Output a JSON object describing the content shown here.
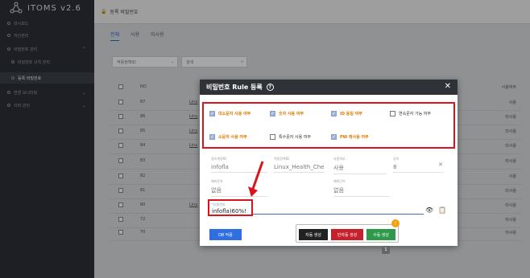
{
  "app": {
    "name": "ITOMS v2.6"
  },
  "sidebar": {
    "items": [
      {
        "label": "대시보드"
      },
      {
        "label": "자산관리"
      },
      {
        "label": "비밀번호 관리"
      },
      {
        "label": "비밀번호 규칙 관리"
      },
      {
        "label": "등록 비밀번호"
      },
      {
        "label": "변경 모니터링"
      },
      {
        "label": "이력 관리"
      }
    ]
  },
  "topbar": {
    "title": "등록 비밀번호"
  },
  "tabs": [
    {
      "label": "전체"
    },
    {
      "label": "사용"
    },
    {
      "label": "미사용"
    }
  ],
  "filter": {
    "select_value": "적용정책ID",
    "search_placeholder": "검색"
  },
  "table": {
    "headers": {
      "no": "NO",
      "status": "사용여부"
    },
    "rows": [
      {
        "no": "87",
        "link": "Linu",
        "status": "사용"
      },
      {
        "no": "86",
        "link": "Linu",
        "status": "미사용"
      },
      {
        "no": "85",
        "link": "Linu",
        "status": "미사용"
      },
      {
        "no": "84",
        "link": "Linu",
        "status": "미사용"
      },
      {
        "no": "83",
        "link": "",
        "status": "미사용"
      },
      {
        "no": "82",
        "link": "",
        "status": "사용"
      },
      {
        "no": "81",
        "link": "",
        "status": "미사용"
      },
      {
        "no": "80",
        "link": "Linu",
        "status": "미사용"
      },
      {
        "no": "72",
        "link": "",
        "status": "미사용"
      },
      {
        "no": "70",
        "link": "",
        "status": "미사용"
      }
    ]
  },
  "modal": {
    "title": "비밀번호 Rule 등록",
    "options": [
      {
        "label": "대소문자 사용 여부",
        "checked": true
      },
      {
        "label": "숫자 사용 여부",
        "checked": true
      },
      {
        "label": "ID 동일 여부",
        "checked": true
      },
      {
        "label": "연속문자 가능 여부",
        "checked": false
      },
      {
        "label": "소문자 사용 여부",
        "checked": true
      },
      {
        "label": "특수문자 사용 여부",
        "checked": false
      },
      {
        "label": "PW 재사용 여부",
        "checked": true
      }
    ],
    "fields": {
      "account_label": "접속계정ID",
      "account_value": "infofla",
      "policy_label": "적용정책ID",
      "policy_value": "Linux_Health_Check",
      "usage_label": "사용여부",
      "usage_value": "사용",
      "length_label": "길이",
      "length_value": "8",
      "desc_label": "예외문자",
      "desc_value": "없음",
      "exc_label": "예외단어",
      "exc_value": "없음"
    },
    "password": {
      "label": "*비밀번호",
      "value": "infofla)60%!"
    },
    "buttons": {
      "db_apply": "DB 적용",
      "auto_gen": "자동 생성",
      "semi_gen": "반자동 생성",
      "manual_gen": "수동 생성"
    },
    "badge": "!"
  },
  "pagination": {
    "current": "1"
  }
}
